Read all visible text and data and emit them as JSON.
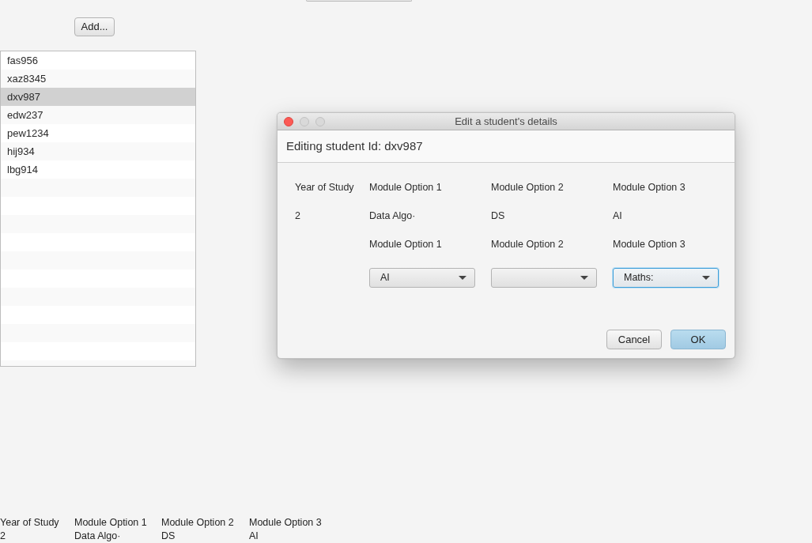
{
  "add_button": {
    "label": "Add..."
  },
  "student_list": {
    "items": [
      {
        "label": "fas956",
        "selected": false
      },
      {
        "label": "xaz8345",
        "selected": false
      },
      {
        "label": "dxv987",
        "selected": true
      },
      {
        "label": "edw237",
        "selected": false
      },
      {
        "label": "pew1234",
        "selected": false
      },
      {
        "label": "hij934",
        "selected": false
      },
      {
        "label": "lbg914",
        "selected": false
      }
    ]
  },
  "dialog": {
    "title": "Edit a student's details",
    "heading": "Editing student Id: dxv987",
    "year_label": "Year of Study",
    "year_value": "2",
    "modules": [
      {
        "label": "Module Option 1",
        "current": "Data Algo·",
        "edit_label": "Module Option 1",
        "choice": "AI",
        "focused": false
      },
      {
        "label": "Module Option 2",
        "current": "DS",
        "edit_label": "Module Option 2",
        "focused": false
      },
      {
        "label": "Module Option 3",
        "current": "AI",
        "edit_label": "Module Option 3",
        "choice": "Maths:",
        "focused": true
      }
    ],
    "buttons": [
      {
        "label": "Cancel",
        "default": false
      },
      {
        "label": "OK",
        "default": true
      }
    ]
  },
  "summary": {
    "headings": [
      "Year of Study",
      "Module Option 1",
      "Module Option 2",
      "Module Option 3"
    ],
    "values": [
      "2",
      "Data Algo·",
      "DS",
      "AI"
    ]
  }
}
